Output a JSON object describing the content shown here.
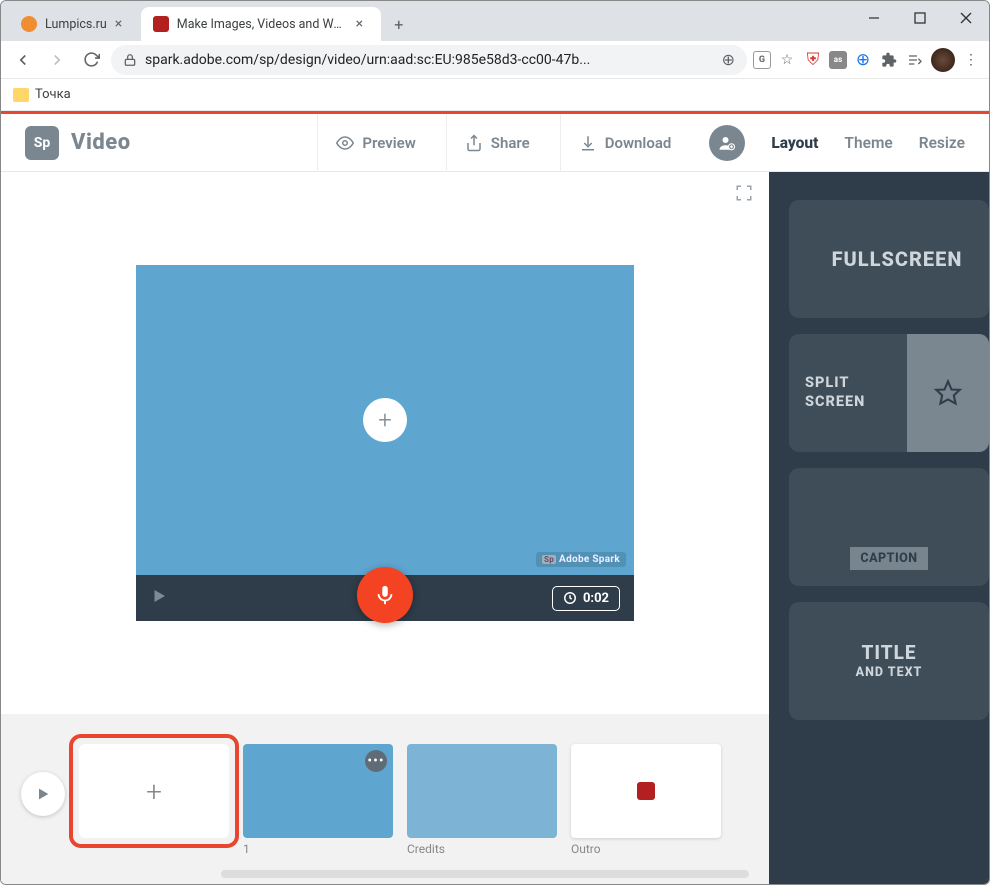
{
  "window": {
    "tabs": [
      {
        "title": "Lumpics.ru",
        "active": false,
        "favicon_color": "#ef8d30"
      },
      {
        "title": "Make Images, Videos and Web S",
        "active": true,
        "favicon_color": "#b2201f"
      }
    ]
  },
  "toolbar": {
    "url_display": "spark.adobe.com/sp/design/video/urn:aad:sc:EU:985e58d3-cc00-47b..."
  },
  "bookmarks": {
    "item1": "Точка"
  },
  "app": {
    "logo_text": "Sp",
    "title": "Video",
    "buttons": {
      "preview": "Preview",
      "share": "Share",
      "download": "Download"
    },
    "nav": {
      "layout": "Layout",
      "theme": "Theme",
      "resize": "Resize"
    }
  },
  "stage": {
    "watermark": "Adobe Spark",
    "duration": "0:02"
  },
  "timeline": {
    "slides": [
      {
        "label": "1",
        "bg": "#5ea5d0"
      },
      {
        "label": "Credits",
        "bg": "#7db4d6"
      },
      {
        "label": "Outro",
        "bg": "#ffffff"
      }
    ]
  },
  "sidebar": {
    "layouts": {
      "fullscreen": "FULLSCREEN",
      "split_line1": "SPLIT",
      "split_line2": "SCREEN",
      "caption": "CAPTION",
      "title_line1": "TITLE",
      "title_line2": "AND TEXT"
    }
  }
}
